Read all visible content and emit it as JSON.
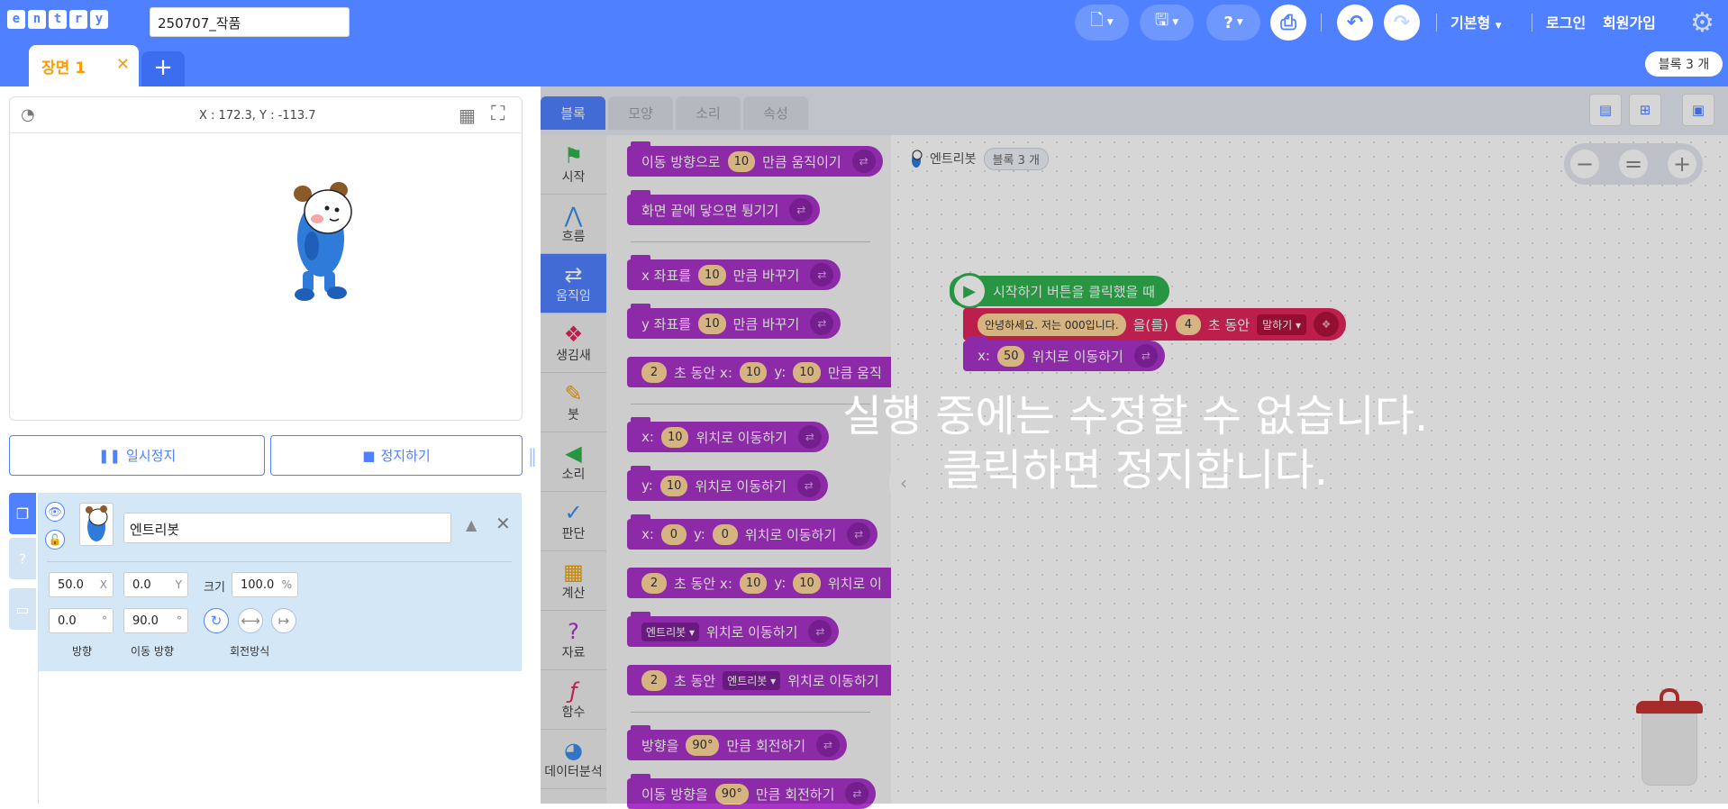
{
  "header": {
    "logo_letters": [
      "e",
      "n",
      "t",
      "r",
      "y"
    ],
    "project_name": "250707_작품",
    "nav_basic": "기본형",
    "login": "로그인",
    "signup": "회원가입",
    "block_count": "블록 3 개"
  },
  "scene_tabs": {
    "scene1": "장면 1",
    "add": "+"
  },
  "stage": {
    "coords": "X : 172.3, Y : -113.7",
    "pause": "일시정지",
    "stop": "정지하기"
  },
  "object": {
    "name": "엔트리봇",
    "x": "50.0",
    "x_unit": "X",
    "y": "0.0",
    "y_unit": "Y",
    "size_label": "크기",
    "size": "100.0",
    "size_unit": "%",
    "direction": "0.0",
    "move_direction": "90.0",
    "direction_label": "방향",
    "move_direction_label": "이동 방향",
    "rotation_label": "회전방식"
  },
  "workspace_tabs": [
    "블록",
    "모양",
    "소리",
    "속성"
  ],
  "categories": [
    "시작",
    "흐름",
    "움직임",
    "생김새",
    "붓",
    "소리",
    "판단",
    "계산",
    "자료",
    "함수",
    "데이터분석"
  ],
  "palette": {
    "b1_a": "이동 방향으로",
    "b1_v": "10",
    "b1_b": "만큼 움직이기",
    "b2": "화면 끝에 닿으면 튕기기",
    "b3_a": "x 좌표를",
    "b3_v": "10",
    "b3_b": "만큼 바꾸기",
    "b4_a": "y 좌표를",
    "b4_v": "10",
    "b4_b": "만큼 바꾸기",
    "b5_v": "2",
    "b5_a": "초 동안 x:",
    "b5_x": "10",
    "b5_b": "y:",
    "b5_y": "10",
    "b5_c": "만큼 움직",
    "b6_a": "x:",
    "b6_v": "10",
    "b6_b": "위치로 이동하기",
    "b7_a": "y:",
    "b7_v": "10",
    "b7_b": "위치로 이동하기",
    "b8_a": "x:",
    "b8_x": "0",
    "b8_b": "y:",
    "b8_y": "0",
    "b8_c": "위치로 이동하기",
    "b9_v": "2",
    "b9_a": "초 동안 x:",
    "b9_x": "10",
    "b9_b": "y:",
    "b9_y": "10",
    "b9_c": "위치로 이",
    "b10_dd": "엔트리봇",
    "b10_a": "위치로 이동하기",
    "b11_v": "2",
    "b11_a": "초 동안",
    "b11_dd": "엔트리봇",
    "b11_b": "위치로 이동하기",
    "b12_a": "방향을",
    "b12_v": "90°",
    "b12_b": "만큼 회전하기",
    "b13_a": "이동 방향을",
    "b13_v": "90°",
    "b13_b": "만큼 회전하기"
  },
  "canvas": {
    "object_label": "엔트리봇",
    "object_block_count": "블록 3 개",
    "start_block": "시작하기 버튼을 클릭했을 때",
    "say_text": "안녕하세요. 저는 000입니다.",
    "say_a": "을(를)",
    "say_sec": "4",
    "say_b": "초 동안",
    "say_dd": "말하기",
    "move_a": "x:",
    "move_v": "50",
    "move_b": "위치로 이동하기"
  },
  "overlay": {
    "line1": "실행 중에는 수정할 수 없습니다.",
    "line2": "클릭하면 정지합니다."
  },
  "colors": {
    "header": "#4f80ff",
    "motion_block": "#a733c8",
    "start_block": "#2fb24e",
    "looks_block": "#e0265a",
    "scene_tab": "#ff9b00"
  }
}
